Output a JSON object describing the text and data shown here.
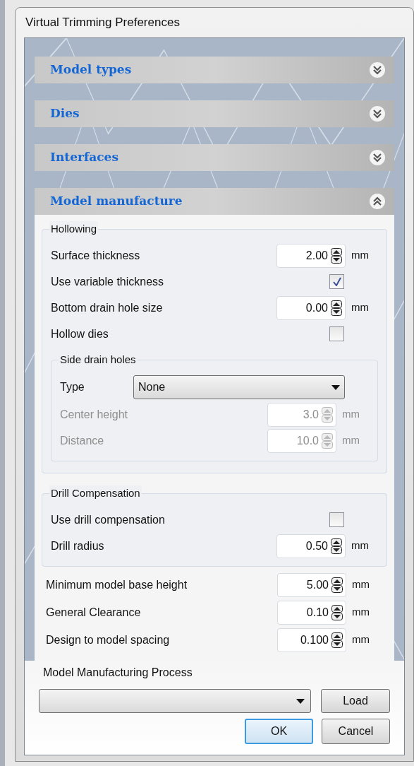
{
  "window": {
    "title": "Virtual Trimming Preferences"
  },
  "sections": [
    {
      "title": "Model types",
      "expanded": false
    },
    {
      "title": "Dies",
      "expanded": false
    },
    {
      "title": "Interfaces",
      "expanded": false
    },
    {
      "title": "Model manufacture",
      "expanded": true,
      "content": {
        "groups": [
          {
            "title": "Hollowing",
            "rows": [
              {
                "kind": "spin",
                "label": "Surface thickness",
                "value": "2.00",
                "unit": "mm",
                "disabled": false
              },
              {
                "kind": "check",
                "label": "Use variable thickness",
                "checked": true
              },
              {
                "kind": "spin",
                "label": "Bottom drain hole size",
                "value": "0.00",
                "unit": "mm",
                "disabled": false
              },
              {
                "kind": "check",
                "label": "Hollow dies",
                "checked": false
              }
            ],
            "subgroup": {
              "title": "Side drain holes",
              "rows": [
                {
                  "kind": "select",
                  "label": "Type",
                  "value": "None"
                },
                {
                  "kind": "spin",
                  "label": "Center height",
                  "value": "3.0",
                  "unit": "mm",
                  "disabled": true
                },
                {
                  "kind": "spin",
                  "label": "Distance",
                  "value": "10.0",
                  "unit": "mm",
                  "disabled": true
                }
              ]
            }
          },
          {
            "title": "Drill Compensation",
            "rows": [
              {
                "kind": "check",
                "label": "Use drill compensation",
                "checked": false
              },
              {
                "kind": "spin",
                "label": "Drill radius",
                "value": "0.50",
                "unit": "mm",
                "disabled": false
              }
            ]
          }
        ],
        "rows": [
          {
            "kind": "spin",
            "label": "Minimum model base height",
            "value": "5.00",
            "unit": "mm",
            "disabled": false
          },
          {
            "kind": "spin",
            "label": "General Clearance",
            "value": "0.10",
            "unit": "mm",
            "disabled": false
          },
          {
            "kind": "spin",
            "label": "Design to model spacing",
            "value": "0.100",
            "unit": "mm",
            "disabled": false
          }
        ]
      }
    }
  ],
  "process": {
    "label": "Model Manufacturing Process",
    "load_button": "Load"
  },
  "buttons": [
    {
      "label": "OK",
      "default": true
    },
    {
      "label": "Cancel",
      "default": false
    }
  ]
}
